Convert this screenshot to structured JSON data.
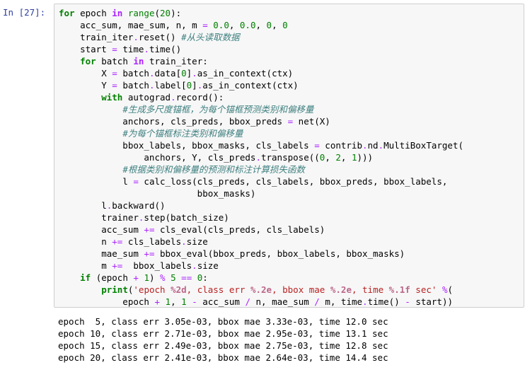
{
  "prompt": "In [27]:",
  "code_lines": [
    [
      {
        "t": "kw",
        "v": "for"
      },
      {
        "t": "",
        "v": " epoch "
      },
      {
        "t": "ow",
        "v": "in"
      },
      {
        "t": "",
        "v": " "
      },
      {
        "t": "nb",
        "v": "range"
      },
      {
        "t": "",
        "v": "("
      },
      {
        "t": "mi",
        "v": "20"
      },
      {
        "t": "",
        "v": "):"
      }
    ],
    [
      {
        "t": "",
        "v": "    acc_sum, mae_sum, n, m "
      },
      {
        "t": "o",
        "v": "="
      },
      {
        "t": "",
        "v": " "
      },
      {
        "t": "mi",
        "v": "0.0"
      },
      {
        "t": "",
        "v": ", "
      },
      {
        "t": "mi",
        "v": "0.0"
      },
      {
        "t": "",
        "v": ", "
      },
      {
        "t": "mi",
        "v": "0"
      },
      {
        "t": "",
        "v": ", "
      },
      {
        "t": "mi",
        "v": "0"
      }
    ],
    [
      {
        "t": "",
        "v": "    train_iter"
      },
      {
        "t": "o",
        "v": "."
      },
      {
        "t": "",
        "v": "reset() "
      },
      {
        "t": "c",
        "v": "#从头读取数据"
      }
    ],
    [
      {
        "t": "",
        "v": "    start "
      },
      {
        "t": "o",
        "v": "="
      },
      {
        "t": "",
        "v": " time"
      },
      {
        "t": "o",
        "v": "."
      },
      {
        "t": "",
        "v": "time()"
      }
    ],
    [
      {
        "t": "",
        "v": "    "
      },
      {
        "t": "kw",
        "v": "for"
      },
      {
        "t": "",
        "v": " batch "
      },
      {
        "t": "ow",
        "v": "in"
      },
      {
        "t": "",
        "v": " train_iter:"
      }
    ],
    [
      {
        "t": "",
        "v": "        X "
      },
      {
        "t": "o",
        "v": "="
      },
      {
        "t": "",
        "v": " batch"
      },
      {
        "t": "o",
        "v": "."
      },
      {
        "t": "",
        "v": "data["
      },
      {
        "t": "mi",
        "v": "0"
      },
      {
        "t": "",
        "v": "]"
      },
      {
        "t": "o",
        "v": "."
      },
      {
        "t": "",
        "v": "as_in_context(ctx)"
      }
    ],
    [
      {
        "t": "",
        "v": "        Y "
      },
      {
        "t": "o",
        "v": "="
      },
      {
        "t": "",
        "v": " batch"
      },
      {
        "t": "o",
        "v": "."
      },
      {
        "t": "",
        "v": "label["
      },
      {
        "t": "mi",
        "v": "0"
      },
      {
        "t": "",
        "v": "]"
      },
      {
        "t": "o",
        "v": "."
      },
      {
        "t": "",
        "v": "as_in_context(ctx)"
      }
    ],
    [
      {
        "t": "",
        "v": "        "
      },
      {
        "t": "kw",
        "v": "with"
      },
      {
        "t": "",
        "v": " autograd"
      },
      {
        "t": "o",
        "v": "."
      },
      {
        "t": "",
        "v": "record():"
      }
    ],
    [
      {
        "t": "",
        "v": "            "
      },
      {
        "t": "c",
        "v": "#生成多尺度锚框，为每个锚框预测类别和偏移量"
      }
    ],
    [
      {
        "t": "",
        "v": "            anchors, cls_preds, bbox_preds "
      },
      {
        "t": "o",
        "v": "="
      },
      {
        "t": "",
        "v": " net(X)"
      }
    ],
    [
      {
        "t": "",
        "v": "            "
      },
      {
        "t": "c",
        "v": "#为每个锚框标注类别和偏移量"
      }
    ],
    [
      {
        "t": "",
        "v": "            bbox_labels, bbox_masks, cls_labels "
      },
      {
        "t": "o",
        "v": "="
      },
      {
        "t": "",
        "v": " contrib"
      },
      {
        "t": "o",
        "v": "."
      },
      {
        "t": "",
        "v": "nd"
      },
      {
        "t": "o",
        "v": "."
      },
      {
        "t": "",
        "v": "MultiBoxTarget("
      }
    ],
    [
      {
        "t": "",
        "v": "                anchors, Y, cls_preds"
      },
      {
        "t": "o",
        "v": "."
      },
      {
        "t": "",
        "v": "transpose(("
      },
      {
        "t": "mi",
        "v": "0"
      },
      {
        "t": "",
        "v": ", "
      },
      {
        "t": "mi",
        "v": "2"
      },
      {
        "t": "",
        "v": ", "
      },
      {
        "t": "mi",
        "v": "1"
      },
      {
        "t": "",
        "v": ")))"
      }
    ],
    [
      {
        "t": "",
        "v": "            "
      },
      {
        "t": "c",
        "v": "#根据类别和偏移量的预测和标注计算损失函数"
      }
    ],
    [
      {
        "t": "",
        "v": "            l "
      },
      {
        "t": "o",
        "v": "="
      },
      {
        "t": "",
        "v": " calc_loss(cls_preds, cls_labels, bbox_preds, bbox_labels,"
      }
    ],
    [
      {
        "t": "",
        "v": "                          bbox_masks)"
      }
    ],
    [
      {
        "t": "",
        "v": "        l"
      },
      {
        "t": "o",
        "v": "."
      },
      {
        "t": "",
        "v": "backward()"
      }
    ],
    [
      {
        "t": "",
        "v": "        trainer"
      },
      {
        "t": "o",
        "v": "."
      },
      {
        "t": "",
        "v": "step(batch_size)"
      }
    ],
    [
      {
        "t": "",
        "v": "        acc_sum "
      },
      {
        "t": "o",
        "v": "+="
      },
      {
        "t": "",
        "v": " cls_eval(cls_preds, cls_labels)"
      }
    ],
    [
      {
        "t": "",
        "v": "        n "
      },
      {
        "t": "o",
        "v": "+="
      },
      {
        "t": "",
        "v": " cls_labels"
      },
      {
        "t": "o",
        "v": "."
      },
      {
        "t": "",
        "v": "size"
      }
    ],
    [
      {
        "t": "",
        "v": "        mae_sum "
      },
      {
        "t": "o",
        "v": "+="
      },
      {
        "t": "",
        "v": " bbox_eval(bbox_preds, bbox_labels, bbox_masks)"
      }
    ],
    [
      {
        "t": "",
        "v": "        m "
      },
      {
        "t": "o",
        "v": "+="
      },
      {
        "t": "",
        "v": "  bbox_labels"
      },
      {
        "t": "o",
        "v": "."
      },
      {
        "t": "",
        "v": "size"
      }
    ],
    [
      {
        "t": "",
        "v": "    "
      },
      {
        "t": "kw",
        "v": "if"
      },
      {
        "t": "",
        "v": " (epoch "
      },
      {
        "t": "o",
        "v": "+"
      },
      {
        "t": "",
        "v": " "
      },
      {
        "t": "mi",
        "v": "1"
      },
      {
        "t": "",
        "v": ") "
      },
      {
        "t": "o",
        "v": "%"
      },
      {
        "t": "",
        "v": " "
      },
      {
        "t": "mi",
        "v": "5"
      },
      {
        "t": "",
        "v": " "
      },
      {
        "t": "o",
        "v": "=="
      },
      {
        "t": "",
        "v": " "
      },
      {
        "t": "mi",
        "v": "0"
      },
      {
        "t": "",
        "v": ":"
      }
    ],
    [
      {
        "t": "",
        "v": "        "
      },
      {
        "t": "kw",
        "v": "print"
      },
      {
        "t": "",
        "v": "("
      },
      {
        "t": "s",
        "v": "'epoch "
      },
      {
        "t": "si",
        "v": "%2d"
      },
      {
        "t": "s",
        "v": ", class err "
      },
      {
        "t": "si",
        "v": "%.2e"
      },
      {
        "t": "s",
        "v": ", bbox mae "
      },
      {
        "t": "si",
        "v": "%.2e"
      },
      {
        "t": "s",
        "v": ", time "
      },
      {
        "t": "si",
        "v": "%.1f"
      },
      {
        "t": "s",
        "v": " sec'"
      },
      {
        "t": "",
        "v": " "
      },
      {
        "t": "o",
        "v": "%"
      },
      {
        "t": "",
        "v": "("
      }
    ],
    [
      {
        "t": "",
        "v": "            epoch "
      },
      {
        "t": "o",
        "v": "+"
      },
      {
        "t": "",
        "v": " "
      },
      {
        "t": "mi",
        "v": "1"
      },
      {
        "t": "",
        "v": ", "
      },
      {
        "t": "mi",
        "v": "1"
      },
      {
        "t": "",
        "v": " "
      },
      {
        "t": "o",
        "v": "-"
      },
      {
        "t": "",
        "v": " acc_sum "
      },
      {
        "t": "o",
        "v": "/"
      },
      {
        "t": "",
        "v": " n, mae_sum "
      },
      {
        "t": "o",
        "v": "/"
      },
      {
        "t": "",
        "v": " m, time"
      },
      {
        "t": "o",
        "v": "."
      },
      {
        "t": "",
        "v": "time() "
      },
      {
        "t": "o",
        "v": "-"
      },
      {
        "t": "",
        "v": " start))"
      }
    ]
  ],
  "output_lines": [
    "epoch  5, class err 3.05e-03, bbox mae 3.33e-03, time 12.0 sec",
    "epoch 10, class err 2.71e-03, bbox mae 2.95e-03, time 13.1 sec",
    "epoch 15, class err 2.49e-03, bbox mae 2.75e-03, time 12.8 sec",
    "epoch 20, class err 2.41e-03, bbox mae 2.64e-03, time 14.4 sec"
  ]
}
